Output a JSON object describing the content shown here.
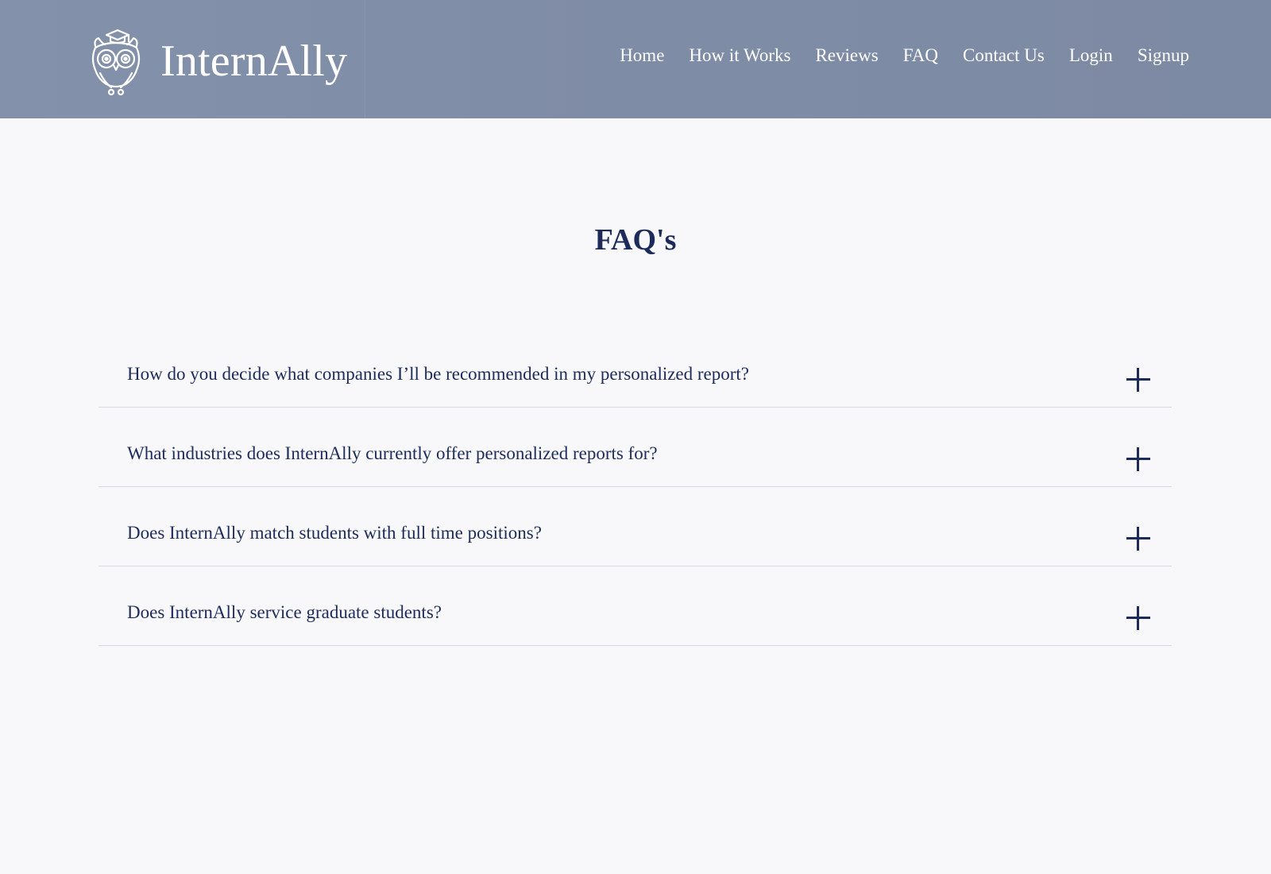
{
  "brand": {
    "name": "InternAlly",
    "logo_icon": "owl-graduate-icon"
  },
  "nav": {
    "items": [
      {
        "label": "Home"
      },
      {
        "label": "How it Works"
      },
      {
        "label": "Reviews"
      },
      {
        "label": "FAQ"
      },
      {
        "label": "Contact Us"
      },
      {
        "label": "Login"
      },
      {
        "label": "Signup"
      }
    ]
  },
  "page": {
    "title": "FAQ's"
  },
  "faq": {
    "items": [
      {
        "question": "How do you decide what companies I’ll be recommended in my personalized report?",
        "icon": "plus-icon"
      },
      {
        "question": "What industries does InternAlly currently offer personalized reports for?",
        "icon": "plus-icon"
      },
      {
        "question": "Does InternAlly match students with full time positions?",
        "icon": "plus-icon"
      },
      {
        "question": "Does InternAlly service graduate students?",
        "icon": "plus-icon"
      }
    ]
  },
  "colors": {
    "header_bg": "#8290a9",
    "accent_navy": "#1c2b5a",
    "page_bg": "#f8f8fa",
    "divider": "#d7d9de"
  }
}
